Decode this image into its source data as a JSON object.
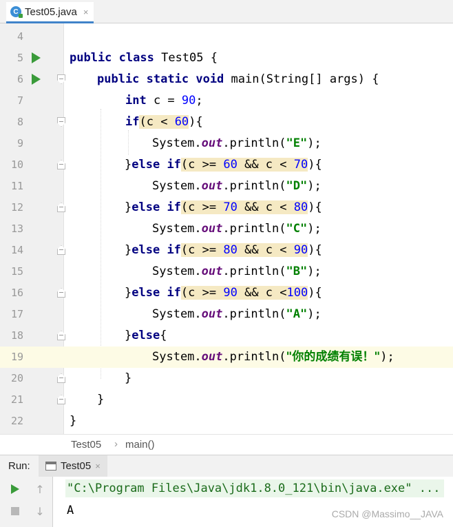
{
  "tab": {
    "filename": "Test05.java",
    "icon": "java-class-icon",
    "close": "×"
  },
  "editor": {
    "line_numbers": [
      "4",
      "5",
      "6",
      "7",
      "8",
      "9",
      "10",
      "11",
      "12",
      "13",
      "14",
      "15",
      "16",
      "17",
      "18",
      "19",
      "20",
      "21",
      "22"
    ],
    "code": {
      "kw_public": "public",
      "kw_class": "class",
      "class_name": " Test05 {",
      "kw_static": "static",
      "kw_void": "void",
      "main_sig": " main(String[] args) {",
      "kw_int": "int",
      "decl_a": " c = ",
      "num_90": "90",
      "semi": ";",
      "kw_if": "if",
      "paren_open": "(",
      "cond_lt60_a": "c < ",
      "num_60": "60",
      "brace_open": "){",
      "sys_out": "System.",
      "out_field": "out",
      "println_open": ".println(",
      "str_e": "\"E\"",
      "str_d": "\"D\"",
      "str_c": "\"C\"",
      "str_b": "\"B\"",
      "str_a": "\"A\"",
      "str_err": "\"你的成绩有误！\"",
      "close_call": ");",
      "kw_else": "else",
      "brace_close": "}",
      "cond_ge": "c >= ",
      "and_lt": " && c < ",
      "and_lt_tight": " && c <",
      "num_70": "70",
      "num_80": "80",
      "num_100": "100",
      "space": " ",
      "else_brace": "{",
      "space_kw_if": " if"
    },
    "current_line": "19"
  },
  "breadcrumb": {
    "items": [
      "Test05",
      "main()"
    ],
    "separator": "›"
  },
  "run_panel": {
    "label": "Run:",
    "tab_label": "Test05",
    "tab_close": "×",
    "command": "\"C:\\Program Files\\Java\\jdk1.8.0_121\\bin\\java.exe\" ...",
    "output": "A"
  },
  "watermark": "CSDN @Massimo__JAVA",
  "colors": {
    "keyword": "#000080",
    "number": "#0000ff",
    "string": "#008000",
    "field": "#660e7a",
    "highlight": "#f5e9c3",
    "run_green": "#3a9b3a"
  }
}
